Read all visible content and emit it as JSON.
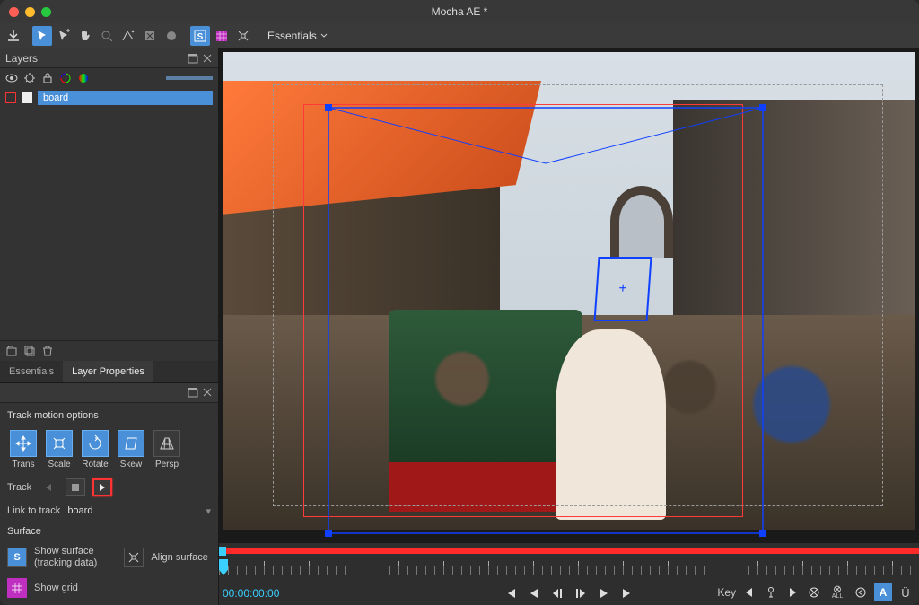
{
  "window": {
    "title": "Mocha AE *"
  },
  "toolbar": {
    "icons": [
      "save",
      "pointer",
      "pointer-add",
      "hand",
      "zoom",
      "bezier",
      "xspline",
      "rectangle",
      "surface",
      "grid",
      "align"
    ],
    "workspace": "Essentials"
  },
  "layers": {
    "panel_title": "Layers",
    "items": [
      {
        "name": "board"
      }
    ],
    "tabs": {
      "essentials": "Essentials",
      "layer_properties": "Layer Properties"
    }
  },
  "track_options": {
    "title": "Track motion options",
    "items": [
      {
        "label": "Trans",
        "active": true
      },
      {
        "label": "Scale",
        "active": true
      },
      {
        "label": "Rotate",
        "active": true
      },
      {
        "label": "Skew",
        "active": true
      },
      {
        "label": "Persp",
        "active": false
      }
    ],
    "track_label": "Track",
    "link_label": "Link to track",
    "link_value": "board"
  },
  "surface": {
    "title": "Surface",
    "show_surface": "Show surface\n(tracking data)",
    "align_surface": "Align surface",
    "show_grid": "Show grid"
  },
  "timeline": {
    "timecode": "00:00:00:00",
    "key_label": "Key",
    "all_label": "ALL"
  }
}
